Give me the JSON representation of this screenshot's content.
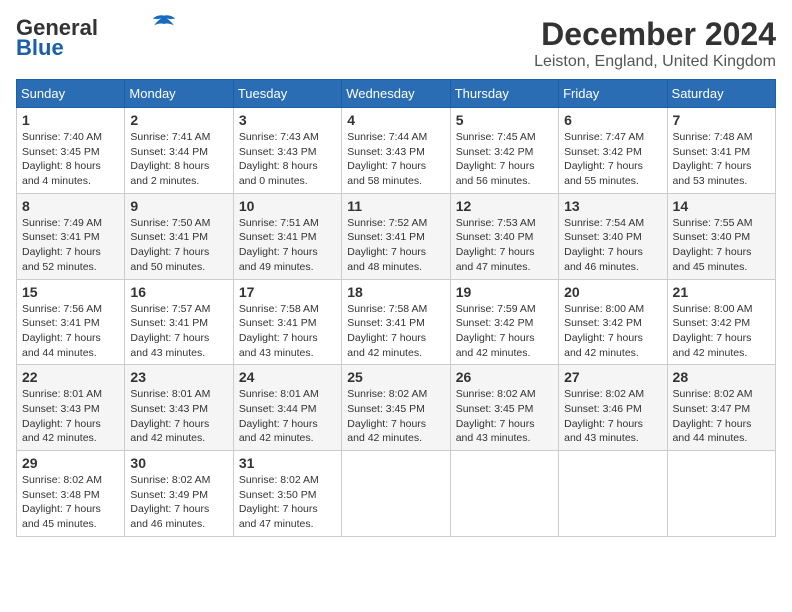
{
  "header": {
    "logo_line1": "General",
    "logo_line2": "Blue",
    "month": "December 2024",
    "location": "Leiston, England, United Kingdom"
  },
  "weekdays": [
    "Sunday",
    "Monday",
    "Tuesday",
    "Wednesday",
    "Thursday",
    "Friday",
    "Saturday"
  ],
  "weeks": [
    [
      {
        "day": 1,
        "sunrise": "7:40 AM",
        "sunset": "3:45 PM",
        "daylight": "8 hours and 4 minutes."
      },
      {
        "day": 2,
        "sunrise": "7:41 AM",
        "sunset": "3:44 PM",
        "daylight": "8 hours and 2 minutes."
      },
      {
        "day": 3,
        "sunrise": "7:43 AM",
        "sunset": "3:43 PM",
        "daylight": "8 hours and 0 minutes."
      },
      {
        "day": 4,
        "sunrise": "7:44 AM",
        "sunset": "3:43 PM",
        "daylight": "7 hours and 58 minutes."
      },
      {
        "day": 5,
        "sunrise": "7:45 AM",
        "sunset": "3:42 PM",
        "daylight": "7 hours and 56 minutes."
      },
      {
        "day": 6,
        "sunrise": "7:47 AM",
        "sunset": "3:42 PM",
        "daylight": "7 hours and 55 minutes."
      },
      {
        "day": 7,
        "sunrise": "7:48 AM",
        "sunset": "3:41 PM",
        "daylight": "7 hours and 53 minutes."
      }
    ],
    [
      {
        "day": 8,
        "sunrise": "7:49 AM",
        "sunset": "3:41 PM",
        "daylight": "7 hours and 52 minutes."
      },
      {
        "day": 9,
        "sunrise": "7:50 AM",
        "sunset": "3:41 PM",
        "daylight": "7 hours and 50 minutes."
      },
      {
        "day": 10,
        "sunrise": "7:51 AM",
        "sunset": "3:41 PM",
        "daylight": "7 hours and 49 minutes."
      },
      {
        "day": 11,
        "sunrise": "7:52 AM",
        "sunset": "3:41 PM",
        "daylight": "7 hours and 48 minutes."
      },
      {
        "day": 12,
        "sunrise": "7:53 AM",
        "sunset": "3:40 PM",
        "daylight": "7 hours and 47 minutes."
      },
      {
        "day": 13,
        "sunrise": "7:54 AM",
        "sunset": "3:40 PM",
        "daylight": "7 hours and 46 minutes."
      },
      {
        "day": 14,
        "sunrise": "7:55 AM",
        "sunset": "3:40 PM",
        "daylight": "7 hours and 45 minutes."
      }
    ],
    [
      {
        "day": 15,
        "sunrise": "7:56 AM",
        "sunset": "3:41 PM",
        "daylight": "7 hours and 44 minutes."
      },
      {
        "day": 16,
        "sunrise": "7:57 AM",
        "sunset": "3:41 PM",
        "daylight": "7 hours and 43 minutes."
      },
      {
        "day": 17,
        "sunrise": "7:58 AM",
        "sunset": "3:41 PM",
        "daylight": "7 hours and 43 minutes."
      },
      {
        "day": 18,
        "sunrise": "7:58 AM",
        "sunset": "3:41 PM",
        "daylight": "7 hours and 42 minutes."
      },
      {
        "day": 19,
        "sunrise": "7:59 AM",
        "sunset": "3:42 PM",
        "daylight": "7 hours and 42 minutes."
      },
      {
        "day": 20,
        "sunrise": "8:00 AM",
        "sunset": "3:42 PM",
        "daylight": "7 hours and 42 minutes."
      },
      {
        "day": 21,
        "sunrise": "8:00 AM",
        "sunset": "3:42 PM",
        "daylight": "7 hours and 42 minutes."
      }
    ],
    [
      {
        "day": 22,
        "sunrise": "8:01 AM",
        "sunset": "3:43 PM",
        "daylight": "7 hours and 42 minutes."
      },
      {
        "day": 23,
        "sunrise": "8:01 AM",
        "sunset": "3:43 PM",
        "daylight": "7 hours and 42 minutes."
      },
      {
        "day": 24,
        "sunrise": "8:01 AM",
        "sunset": "3:44 PM",
        "daylight": "7 hours and 42 minutes."
      },
      {
        "day": 25,
        "sunrise": "8:02 AM",
        "sunset": "3:45 PM",
        "daylight": "7 hours and 42 minutes."
      },
      {
        "day": 26,
        "sunrise": "8:02 AM",
        "sunset": "3:45 PM",
        "daylight": "7 hours and 43 minutes."
      },
      {
        "day": 27,
        "sunrise": "8:02 AM",
        "sunset": "3:46 PM",
        "daylight": "7 hours and 43 minutes."
      },
      {
        "day": 28,
        "sunrise": "8:02 AM",
        "sunset": "3:47 PM",
        "daylight": "7 hours and 44 minutes."
      }
    ],
    [
      {
        "day": 29,
        "sunrise": "8:02 AM",
        "sunset": "3:48 PM",
        "daylight": "7 hours and 45 minutes."
      },
      {
        "day": 30,
        "sunrise": "8:02 AM",
        "sunset": "3:49 PM",
        "daylight": "7 hours and 46 minutes."
      },
      {
        "day": 31,
        "sunrise": "8:02 AM",
        "sunset": "3:50 PM",
        "daylight": "7 hours and 47 minutes."
      },
      null,
      null,
      null,
      null
    ]
  ]
}
